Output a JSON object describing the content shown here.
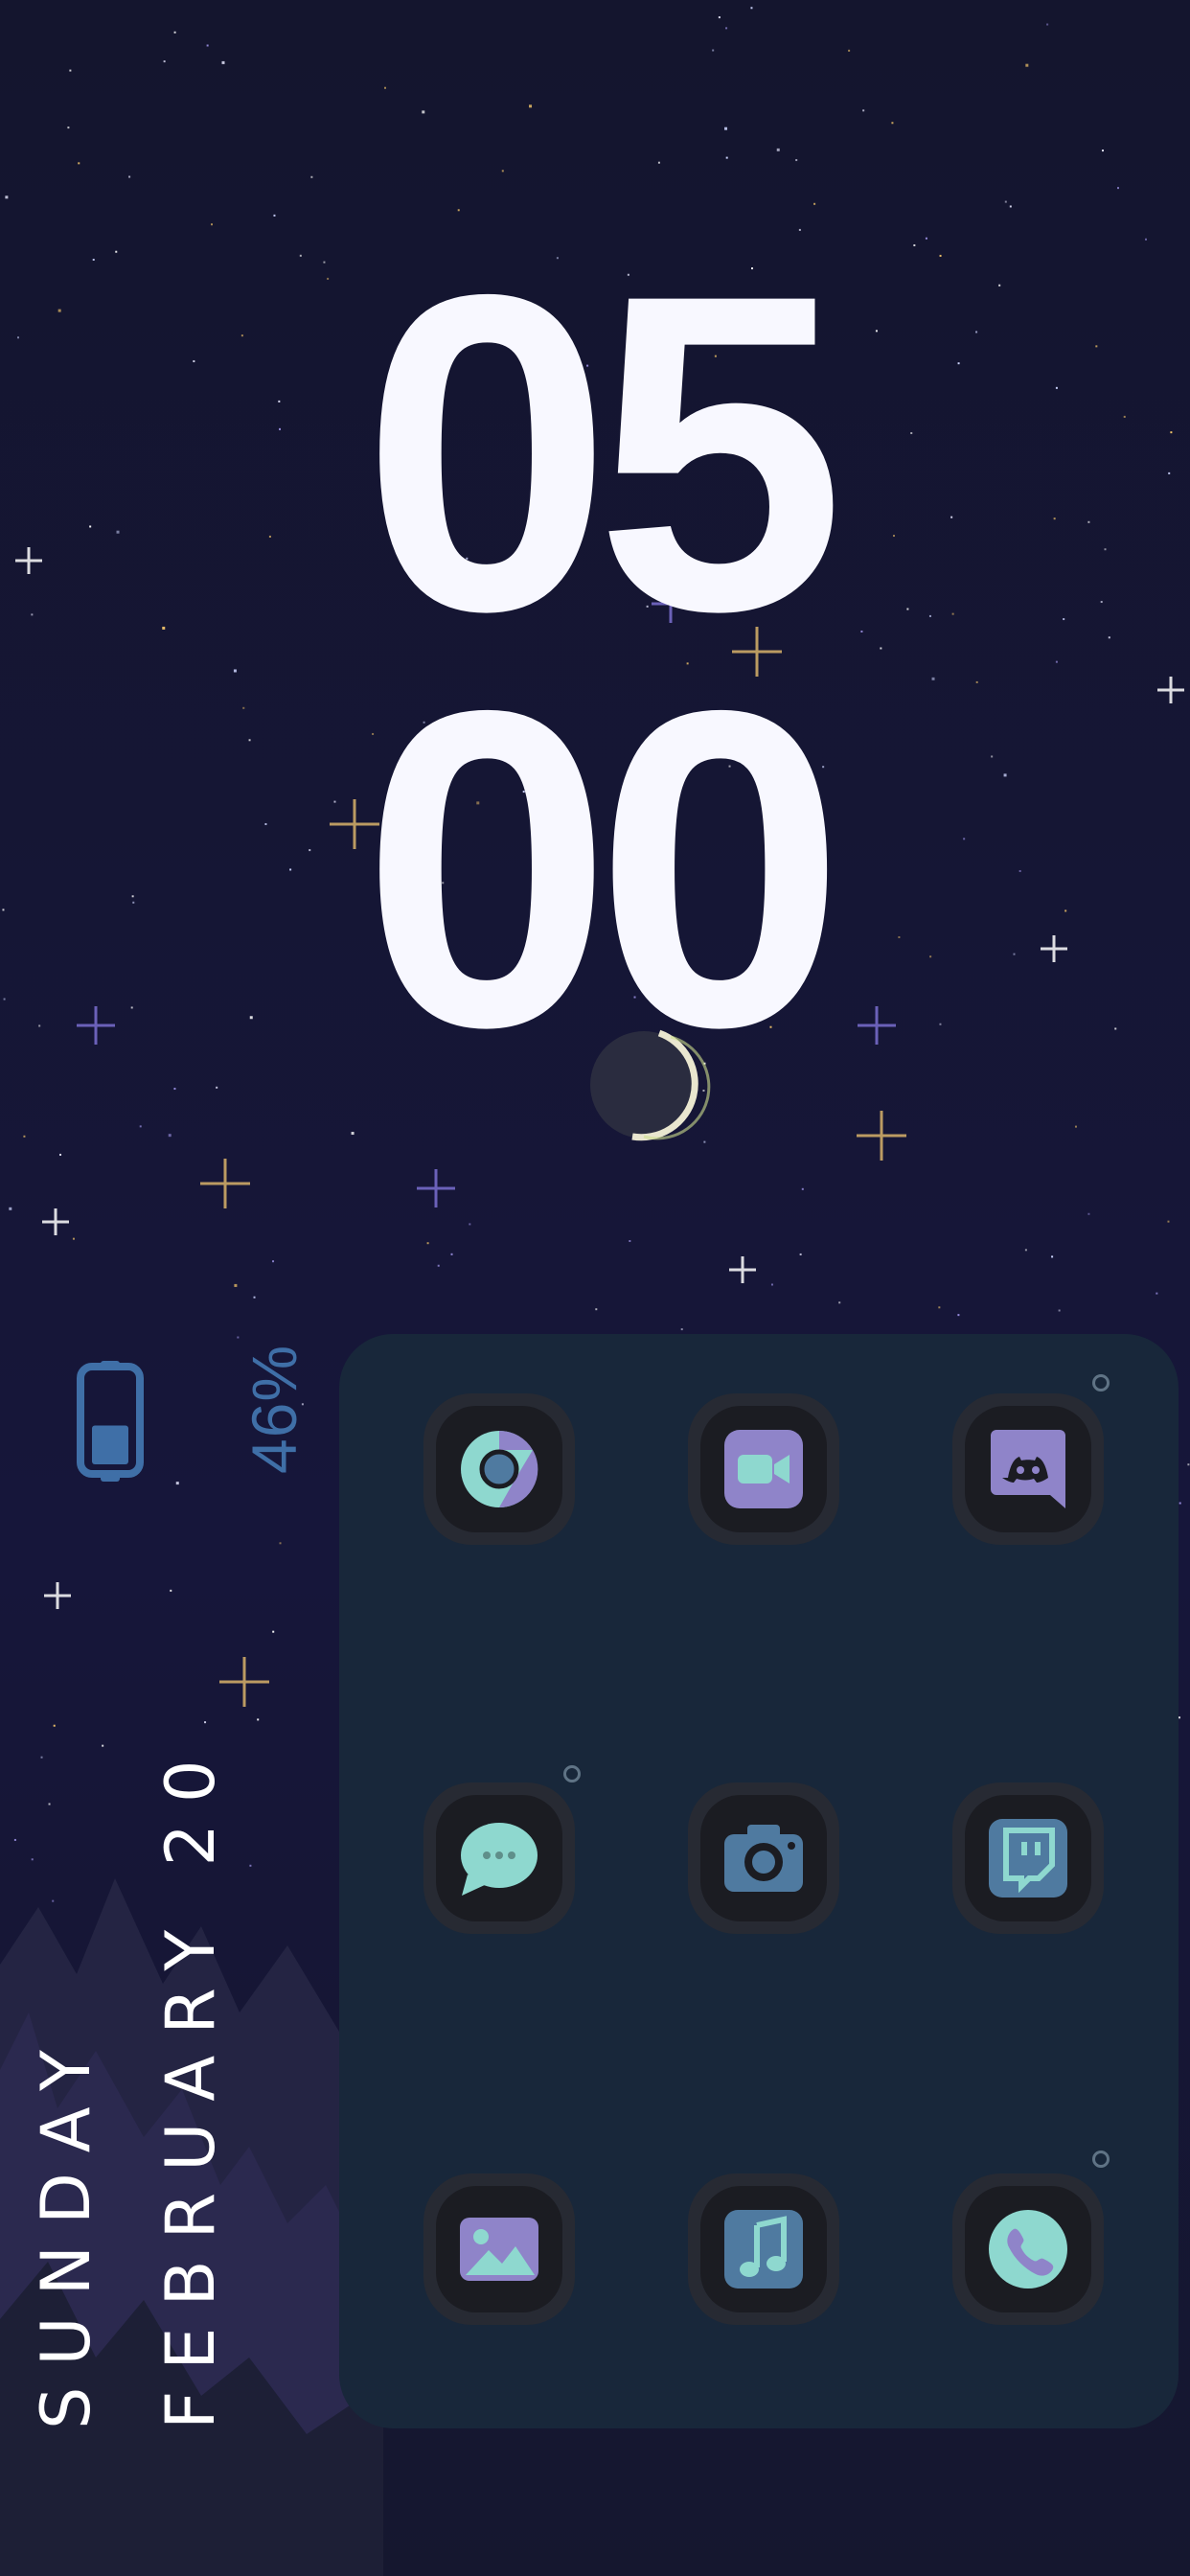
{
  "clock": {
    "hours": "05",
    "minutes": "00"
  },
  "battery": {
    "percent_text": "46%",
    "level": 0.46,
    "color": "#3f6fa7"
  },
  "date": {
    "weekday": "SUNDAY",
    "month_day": "FEBRUARY 20"
  },
  "panel": {
    "color": "#18273a"
  },
  "apps": [
    {
      "name": "chrome",
      "icon": "chrome-icon",
      "notification": false
    },
    {
      "name": "video",
      "icon": "video-camera-icon",
      "notification": false
    },
    {
      "name": "discord",
      "icon": "discord-icon",
      "notification": true
    },
    {
      "name": "messages",
      "icon": "chat-bubble-icon",
      "notification": true
    },
    {
      "name": "camera",
      "icon": "camera-icon",
      "notification": false
    },
    {
      "name": "twitch",
      "icon": "twitch-icon",
      "notification": false
    },
    {
      "name": "gallery",
      "icon": "image-icon",
      "notification": false
    },
    {
      "name": "music",
      "icon": "music-note-icon",
      "notification": false
    },
    {
      "name": "phone",
      "icon": "phone-icon",
      "notification": true
    }
  ],
  "colors": {
    "background": "#141530",
    "clock": "#f8f8ff",
    "teal": "#8ed8cf",
    "purple": "#8f84c9",
    "steel": "#4f7aa0"
  }
}
